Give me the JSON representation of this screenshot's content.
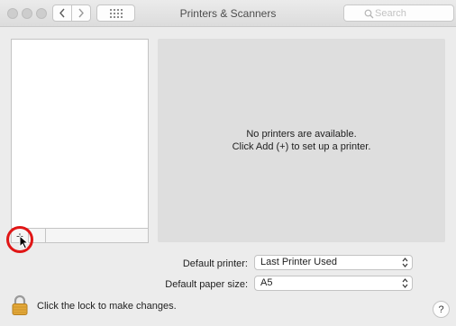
{
  "window": {
    "title": "Printers & Scanners",
    "search_placeholder": "Search"
  },
  "toolbar": {
    "back_icon": "chevron-left-icon",
    "forward_icon": "chevron-right-icon",
    "show_all_icon": "grid-icon"
  },
  "printer_list": {
    "items": [],
    "add_label": "+",
    "remove_label": ""
  },
  "detail": {
    "line1": "No printers are available.",
    "line2": "Click Add (+) to set up a printer."
  },
  "defaults": {
    "printer_label": "Default printer:",
    "printer_value": "Last Printer Used",
    "paper_label": "Default paper size:",
    "paper_value": "A5"
  },
  "footer": {
    "lock_text": "Click the lock to make changes.",
    "help_label": "?"
  },
  "colors": {
    "highlight_ring": "#e01616",
    "lock_body": "#e3a83a"
  }
}
